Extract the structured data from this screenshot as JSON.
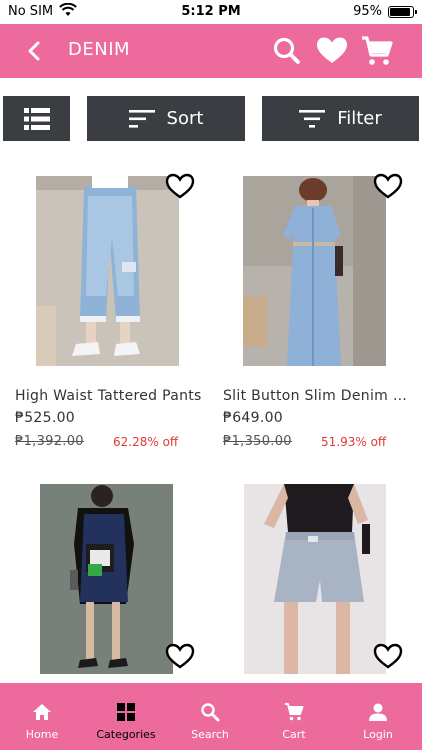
{
  "status_bar": {
    "carrier": "No SIM",
    "time": "5:12 PM",
    "battery": "95%"
  },
  "header": {
    "title": "DENIM",
    "icons": [
      "back-icon",
      "search-icon",
      "heart-icon",
      "cart-icon"
    ],
    "bg_color": "#ec6a9c"
  },
  "toolbar": {
    "sort_label": "Sort",
    "filter_label": "Filter",
    "bg_color": "#3a3d42"
  },
  "products": [
    {
      "name": "High Waist Tattered Pants",
      "price": "₱525.00",
      "old_price": "₱1,392.00",
      "discount": "62.28% off"
    },
    {
      "name": "Slit Button Slim Denim Dress",
      "price": "₱649.00",
      "old_price": "₱1,350.00",
      "discount": "51.93% off"
    },
    {
      "name": "",
      "price": "",
      "old_price": "",
      "discount": ""
    },
    {
      "name": "",
      "price": "",
      "old_price": "",
      "discount": ""
    }
  ],
  "bottom_nav": {
    "items": [
      {
        "label": "Home",
        "icon": "home-icon"
      },
      {
        "label": "Categories",
        "icon": "grid-icon"
      },
      {
        "label": "Search",
        "icon": "search-icon"
      },
      {
        "label": "Cart",
        "icon": "cart-icon"
      },
      {
        "label": "Login",
        "icon": "user-icon"
      }
    ],
    "active_index": 1,
    "discount_color": "#e53935"
  }
}
